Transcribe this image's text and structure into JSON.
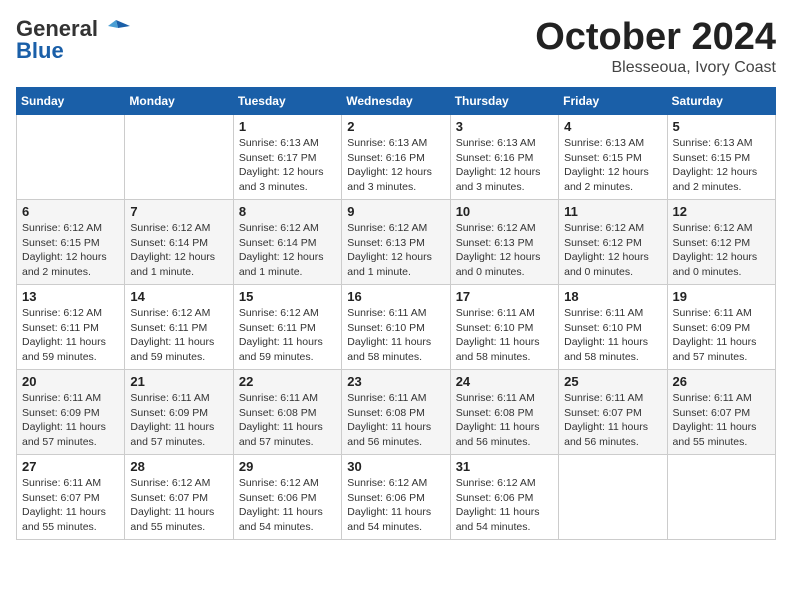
{
  "logo": {
    "line1": "General",
    "line2": "Blue"
  },
  "header": {
    "month": "October 2024",
    "location": "Blesseoua, Ivory Coast"
  },
  "weekdays": [
    "Sunday",
    "Monday",
    "Tuesday",
    "Wednesday",
    "Thursday",
    "Friday",
    "Saturday"
  ],
  "weeks": [
    [
      {
        "day": "",
        "info": ""
      },
      {
        "day": "",
        "info": ""
      },
      {
        "day": "1",
        "info": "Sunrise: 6:13 AM\nSunset: 6:17 PM\nDaylight: 12 hours and 3 minutes."
      },
      {
        "day": "2",
        "info": "Sunrise: 6:13 AM\nSunset: 6:16 PM\nDaylight: 12 hours and 3 minutes."
      },
      {
        "day": "3",
        "info": "Sunrise: 6:13 AM\nSunset: 6:16 PM\nDaylight: 12 hours and 3 minutes."
      },
      {
        "day": "4",
        "info": "Sunrise: 6:13 AM\nSunset: 6:15 PM\nDaylight: 12 hours and 2 minutes."
      },
      {
        "day": "5",
        "info": "Sunrise: 6:13 AM\nSunset: 6:15 PM\nDaylight: 12 hours and 2 minutes."
      }
    ],
    [
      {
        "day": "6",
        "info": "Sunrise: 6:12 AM\nSunset: 6:15 PM\nDaylight: 12 hours and 2 minutes."
      },
      {
        "day": "7",
        "info": "Sunrise: 6:12 AM\nSunset: 6:14 PM\nDaylight: 12 hours and 1 minute."
      },
      {
        "day": "8",
        "info": "Sunrise: 6:12 AM\nSunset: 6:14 PM\nDaylight: 12 hours and 1 minute."
      },
      {
        "day": "9",
        "info": "Sunrise: 6:12 AM\nSunset: 6:13 PM\nDaylight: 12 hours and 1 minute."
      },
      {
        "day": "10",
        "info": "Sunrise: 6:12 AM\nSunset: 6:13 PM\nDaylight: 12 hours and 0 minutes."
      },
      {
        "day": "11",
        "info": "Sunrise: 6:12 AM\nSunset: 6:12 PM\nDaylight: 12 hours and 0 minutes."
      },
      {
        "day": "12",
        "info": "Sunrise: 6:12 AM\nSunset: 6:12 PM\nDaylight: 12 hours and 0 minutes."
      }
    ],
    [
      {
        "day": "13",
        "info": "Sunrise: 6:12 AM\nSunset: 6:11 PM\nDaylight: 11 hours and 59 minutes."
      },
      {
        "day": "14",
        "info": "Sunrise: 6:12 AM\nSunset: 6:11 PM\nDaylight: 11 hours and 59 minutes."
      },
      {
        "day": "15",
        "info": "Sunrise: 6:12 AM\nSunset: 6:11 PM\nDaylight: 11 hours and 59 minutes."
      },
      {
        "day": "16",
        "info": "Sunrise: 6:11 AM\nSunset: 6:10 PM\nDaylight: 11 hours and 58 minutes."
      },
      {
        "day": "17",
        "info": "Sunrise: 6:11 AM\nSunset: 6:10 PM\nDaylight: 11 hours and 58 minutes."
      },
      {
        "day": "18",
        "info": "Sunrise: 6:11 AM\nSunset: 6:10 PM\nDaylight: 11 hours and 58 minutes."
      },
      {
        "day": "19",
        "info": "Sunrise: 6:11 AM\nSunset: 6:09 PM\nDaylight: 11 hours and 57 minutes."
      }
    ],
    [
      {
        "day": "20",
        "info": "Sunrise: 6:11 AM\nSunset: 6:09 PM\nDaylight: 11 hours and 57 minutes."
      },
      {
        "day": "21",
        "info": "Sunrise: 6:11 AM\nSunset: 6:09 PM\nDaylight: 11 hours and 57 minutes."
      },
      {
        "day": "22",
        "info": "Sunrise: 6:11 AM\nSunset: 6:08 PM\nDaylight: 11 hours and 57 minutes."
      },
      {
        "day": "23",
        "info": "Sunrise: 6:11 AM\nSunset: 6:08 PM\nDaylight: 11 hours and 56 minutes."
      },
      {
        "day": "24",
        "info": "Sunrise: 6:11 AM\nSunset: 6:08 PM\nDaylight: 11 hours and 56 minutes."
      },
      {
        "day": "25",
        "info": "Sunrise: 6:11 AM\nSunset: 6:07 PM\nDaylight: 11 hours and 56 minutes."
      },
      {
        "day": "26",
        "info": "Sunrise: 6:11 AM\nSunset: 6:07 PM\nDaylight: 11 hours and 55 minutes."
      }
    ],
    [
      {
        "day": "27",
        "info": "Sunrise: 6:11 AM\nSunset: 6:07 PM\nDaylight: 11 hours and 55 minutes."
      },
      {
        "day": "28",
        "info": "Sunrise: 6:12 AM\nSunset: 6:07 PM\nDaylight: 11 hours and 55 minutes."
      },
      {
        "day": "29",
        "info": "Sunrise: 6:12 AM\nSunset: 6:06 PM\nDaylight: 11 hours and 54 minutes."
      },
      {
        "day": "30",
        "info": "Sunrise: 6:12 AM\nSunset: 6:06 PM\nDaylight: 11 hours and 54 minutes."
      },
      {
        "day": "31",
        "info": "Sunrise: 6:12 AM\nSunset: 6:06 PM\nDaylight: 11 hours and 54 minutes."
      },
      {
        "day": "",
        "info": ""
      },
      {
        "day": "",
        "info": ""
      }
    ]
  ]
}
